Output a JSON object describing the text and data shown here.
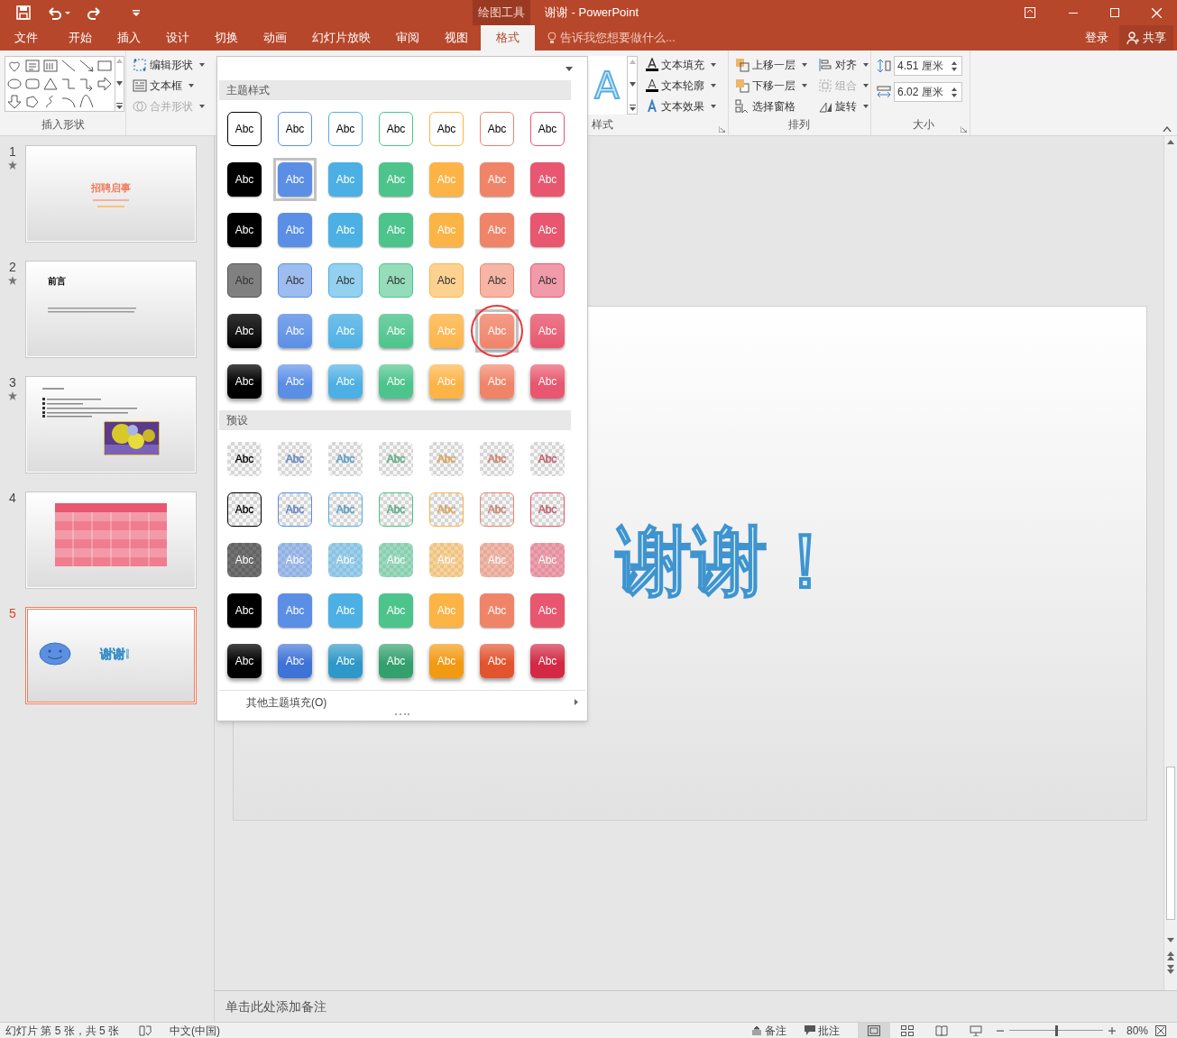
{
  "title_bar": {
    "context_label": "绘图工具",
    "title": "谢谢 - PowerPoint"
  },
  "tabs": [
    {
      "label": "文件",
      "selected": false
    },
    {
      "label": "开始",
      "selected": false
    },
    {
      "label": "插入",
      "selected": false
    },
    {
      "label": "设计",
      "selected": false
    },
    {
      "label": "切换",
      "selected": false
    },
    {
      "label": "动画",
      "selected": false
    },
    {
      "label": "幻灯片放映",
      "selected": false
    },
    {
      "label": "审阅",
      "selected": false
    },
    {
      "label": "视图",
      "selected": false
    },
    {
      "label": "格式",
      "selected": true
    }
  ],
  "tell_me": "告诉我您想要做什么...",
  "sign_in": "登录",
  "share": "共享",
  "ribbon": {
    "insert_shapes": {
      "label": "插入形状",
      "commands": [
        {
          "label": "编辑形状",
          "disabled": false
        },
        {
          "label": "文本框",
          "disabled": false
        },
        {
          "label": "合并形状",
          "disabled": true
        }
      ]
    },
    "wordart_styles": {
      "label": "样式",
      "preview": "A",
      "commands": [
        {
          "label": "文本填充",
          "disabled": false
        },
        {
          "label": "文本轮廓",
          "disabled": false
        },
        {
          "label": "文本效果",
          "disabled": false
        }
      ]
    },
    "arrange": {
      "label": "排列",
      "commands": [
        {
          "label": "上移一层",
          "disabled": false
        },
        {
          "label": "对齐",
          "disabled": false
        },
        {
          "label": "下移一层",
          "disabled": false
        },
        {
          "label": "组合",
          "disabled": true
        },
        {
          "label": "选择窗格",
          "disabled": false
        },
        {
          "label": "旋转",
          "disabled": false
        }
      ]
    },
    "size": {
      "label": "大小",
      "height": "4.51 厘米",
      "width": "6.02 厘米"
    }
  },
  "style_gallery": {
    "sections": [
      {
        "title": "主题样式",
        "rows": [
          {
            "kind": "outline",
            "swatches": [
              {
                "label": "Abc",
                "selected": false,
                "circled": false
              },
              {
                "label": "Abc",
                "selected": false,
                "circled": false
              },
              {
                "label": "Abc",
                "selected": false,
                "circled": false
              },
              {
                "label": "Abc",
                "selected": false,
                "circled": false
              },
              {
                "label": "Abc",
                "selected": false,
                "circled": false
              },
              {
                "label": "Abc",
                "selected": false,
                "circled": false
              },
              {
                "label": "Abc",
                "selected": false,
                "circled": false
              }
            ]
          },
          {
            "kind": "solid",
            "swatches": [
              {
                "label": "Abc",
                "selected": false,
                "circled": false
              },
              {
                "label": "Abc",
                "selected": true,
                "circled": false
              },
              {
                "label": "Abc",
                "selected": false,
                "circled": false
              },
              {
                "label": "Abc",
                "selected": false,
                "circled": false
              },
              {
                "label": "Abc",
                "selected": false,
                "circled": false
              },
              {
                "label": "Abc",
                "selected": false,
                "circled": false
              },
              {
                "label": "Abc",
                "selected": false,
                "circled": false
              }
            ]
          },
          {
            "kind": "solid",
            "swatches": [
              {
                "label": "Abc",
                "selected": false,
                "circled": false
              },
              {
                "label": "Abc",
                "selected": false,
                "circled": false
              },
              {
                "label": "Abc",
                "selected": false,
                "circled": false
              },
              {
                "label": "Abc",
                "selected": false,
                "circled": false
              },
              {
                "label": "Abc",
                "selected": false,
                "circled": false
              },
              {
                "label": "Abc",
                "selected": false,
                "circled": false
              },
              {
                "label": "Abc",
                "selected": false,
                "circled": false
              }
            ]
          },
          {
            "kind": "light",
            "swatches": [
              {
                "label": "Abc",
                "selected": false,
                "circled": false
              },
              {
                "label": "Abc",
                "selected": false,
                "circled": false
              },
              {
                "label": "Abc",
                "selected": false,
                "circled": false
              },
              {
                "label": "Abc",
                "selected": false,
                "circled": false
              },
              {
                "label": "Abc",
                "selected": false,
                "circled": false
              },
              {
                "label": "Abc",
                "selected": false,
                "circled": false
              },
              {
                "label": "Abc",
                "selected": false,
                "circled": false
              }
            ]
          },
          {
            "kind": "gradient",
            "swatches": [
              {
                "label": "Abc",
                "selected": false,
                "circled": false
              },
              {
                "label": "Abc",
                "selected": false,
                "circled": false
              },
              {
                "label": "Abc",
                "selected": false,
                "circled": false
              },
              {
                "label": "Abc",
                "selected": false,
                "circled": false
              },
              {
                "label": "Abc",
                "selected": false,
                "circled": false
              },
              {
                "label": "Abc",
                "selected": true,
                "circled": true
              },
              {
                "label": "Abc",
                "selected": false,
                "circled": false
              }
            ]
          },
          {
            "kind": "gradient_strong",
            "swatches": [
              {
                "label": "Abc",
                "selected": false,
                "circled": false
              },
              {
                "label": "Abc",
                "selected": false,
                "circled": false
              },
              {
                "label": "Abc",
                "selected": false,
                "circled": false
              },
              {
                "label": "Abc",
                "selected": false,
                "circled": false
              },
              {
                "label": "Abc",
                "selected": false,
                "circled": false
              },
              {
                "label": "Abc",
                "selected": false,
                "circled": false
              },
              {
                "label": "Abc",
                "selected": false,
                "circled": false
              }
            ]
          }
        ]
      },
      {
        "title": "预设",
        "rows": [
          {
            "kind": "clear",
            "swatches": [
              {
                "label": "Abc",
                "selected": false,
                "circled": false
              },
              {
                "label": "Abc",
                "selected": false,
                "circled": false
              },
              {
                "label": "Abc",
                "selected": false,
                "circled": false
              },
              {
                "label": "Abc",
                "selected": false,
                "circled": false
              },
              {
                "label": "Abc",
                "selected": false,
                "circled": false
              },
              {
                "label": "Abc",
                "selected": false,
                "circled": false
              },
              {
                "label": "Abc",
                "selected": false,
                "circled": false
              }
            ]
          },
          {
            "kind": "clear_outline",
            "swatches": [
              {
                "label": "Abc",
                "selected": false,
                "circled": false
              },
              {
                "label": "Abc",
                "selected": false,
                "circled": false
              },
              {
                "label": "Abc",
                "selected": false,
                "circled": false
              },
              {
                "label": "Abc",
                "selected": false,
                "circled": false
              },
              {
                "label": "Abc",
                "selected": false,
                "circled": false
              },
              {
                "label": "Abc",
                "selected": false,
                "circled": false
              },
              {
                "label": "Abc",
                "selected": false,
                "circled": false
              }
            ]
          },
          {
            "kind": "clear_tint",
            "swatches": [
              {
                "label": "Abc",
                "selected": false,
                "circled": false
              },
              {
                "label": "Abc",
                "selected": false,
                "circled": false
              },
              {
                "label": "Abc",
                "selected": false,
                "circled": false
              },
              {
                "label": "Abc",
                "selected": false,
                "circled": false
              },
              {
                "label": "Abc",
                "selected": false,
                "circled": false
              },
              {
                "label": "Abc",
                "selected": false,
                "circled": false
              },
              {
                "label": "Abc",
                "selected": false,
                "circled": false
              }
            ]
          },
          {
            "kind": "solid",
            "swatches": [
              {
                "label": "Abc",
                "selected": false,
                "circled": false
              },
              {
                "label": "Abc",
                "selected": false,
                "circled": false
              },
              {
                "label": "Abc",
                "selected": false,
                "circled": false
              },
              {
                "label": "Abc",
                "selected": false,
                "circled": false
              },
              {
                "label": "Abc",
                "selected": false,
                "circled": false
              },
              {
                "label": "Abc",
                "selected": false,
                "circled": false
              },
              {
                "label": "Abc",
                "selected": false,
                "circled": false
              }
            ]
          },
          {
            "kind": "gradient_deep",
            "swatches": [
              {
                "label": "Abc",
                "selected": false,
                "circled": false
              },
              {
                "label": "Abc",
                "selected": false,
                "circled": false
              },
              {
                "label": "Abc",
                "selected": false,
                "circled": false
              },
              {
                "label": "Abc",
                "selected": false,
                "circled": false
              },
              {
                "label": "Abc",
                "selected": false,
                "circled": false
              },
              {
                "label": "Abc",
                "selected": false,
                "circled": false
              },
              {
                "label": "Abc",
                "selected": false,
                "circled": false
              }
            ]
          }
        ]
      }
    ],
    "more": "其他主题填充(O)"
  },
  "slides": [
    {
      "number": "1",
      "kind": "title",
      "has_animation": true,
      "selected": false,
      "text": "招聘启事"
    },
    {
      "number": "2",
      "kind": "heading",
      "has_animation": true,
      "selected": false,
      "text": "前言"
    },
    {
      "number": "3",
      "kind": "bullets",
      "has_animation": true,
      "selected": false
    },
    {
      "number": "4",
      "kind": "table",
      "has_animation": false,
      "selected": false
    },
    {
      "number": "5",
      "kind": "thanks",
      "has_animation": false,
      "selected": true,
      "text": "谢谢!"
    }
  ],
  "current_slide": {
    "text": "谢谢！"
  },
  "notes_placeholder": "单击此处添加备注",
  "status_bar": {
    "slide_info": "幻灯片 第 5 张，共 5 张",
    "language": "中文(中国)",
    "notes": "备注",
    "comments": "批注",
    "zoom": "80%",
    "level": 0.5
  }
}
